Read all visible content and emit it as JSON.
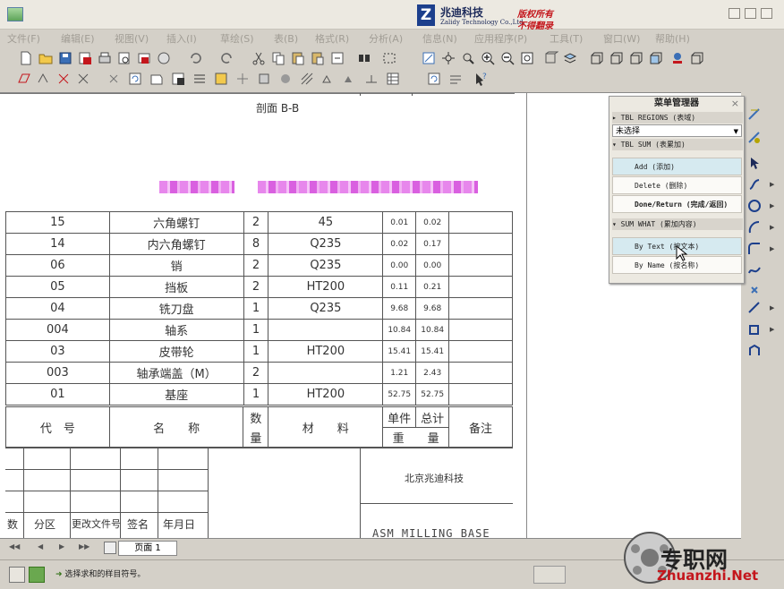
{
  "titlebar": {
    "logo_letter": "Z",
    "company": "兆迪科技",
    "company_en": "Zalidy Technology Co.,Ltd.",
    "copyright_1": "版权所有",
    "copyright_2": "不得翻录"
  },
  "menubar": {
    "items": [
      "文件(F)",
      "编辑(E)",
      "视图(V)",
      "插入(I)",
      "草绘(S)",
      "表(B)",
      "格式(R)",
      "分析(A)",
      "信息(N)",
      "应用程序(P)",
      "工具(T)",
      "窗口(W)",
      "帮助(H)"
    ]
  },
  "drawing": {
    "section_label": "剖面 B-B",
    "bom_rows": [
      {
        "code": "15",
        "name": "六角螺钉",
        "qty": "2",
        "material": "45",
        "unit_w": "0.01",
        "total_w": "0.02",
        "note": ""
      },
      {
        "code": "14",
        "name": "内六角螺钉",
        "qty": "8",
        "material": "Q235",
        "unit_w": "0.02",
        "total_w": "0.17",
        "note": ""
      },
      {
        "code": "06",
        "name": "销",
        "qty": "2",
        "material": "Q235",
        "unit_w": "0.00",
        "total_w": "0.00",
        "note": ""
      },
      {
        "code": "05",
        "name": "挡板",
        "qty": "2",
        "material": "HT200",
        "unit_w": "0.11",
        "total_w": "0.21",
        "note": ""
      },
      {
        "code": "04",
        "name": "铣刀盘",
        "qty": "1",
        "material": "Q235",
        "unit_w": "9.68",
        "total_w": "9.68",
        "note": ""
      },
      {
        "code": "004",
        "name": "轴系",
        "qty": "1",
        "material": "",
        "unit_w": "10.84",
        "total_w": "10.84",
        "note": ""
      },
      {
        "code": "03",
        "name": "皮带轮",
        "qty": "1",
        "material": "HT200",
        "unit_w": "15.41",
        "total_w": "15.41",
        "note": ""
      },
      {
        "code": "003",
        "name": "轴承端盖（M）",
        "qty": "2",
        "material": "",
        "unit_w": "1.21",
        "total_w": "2.43",
        "note": ""
      },
      {
        "code": "01",
        "name": "基座",
        "qty": "1",
        "material": "HT200",
        "unit_w": "52.75",
        "total_w": "52.75",
        "note": ""
      }
    ],
    "header": {
      "code": "代　号",
      "name": "名　　称",
      "qty_1": "数",
      "qty_2": "量",
      "material": "材　　料",
      "unit_w": "单件",
      "total_w": "总计",
      "weight": "重　　量",
      "note": "备注"
    },
    "title_block": {
      "company": "北京兆迪科技",
      "assembly_name": "ASM MILLING BASE",
      "rev_cols": [
        "数",
        "分区",
        "更改文件号",
        "签名",
        "年月日"
      ]
    }
  },
  "menu_manager": {
    "title": "菜单管理器",
    "close": "×",
    "sec_regions": "▸ TBL REGIONS (表域)",
    "region_select": "未选择",
    "sec_sum": "▾ TBL SUM (表累加)",
    "btn_add": "Add (添加)",
    "btn_delete": "Delete (删除)",
    "btn_done": "Done/Return (完成/返回)",
    "sec_sum_what": "▾ SUM WHAT (累加内容)",
    "btn_by_text": "By Text (按文本)",
    "btn_by_name": "By Name (按名称)"
  },
  "page_tabs": {
    "page_label": "页面 1"
  },
  "status": {
    "message": "选择求和的样目符号。"
  },
  "watermark": {
    "text": "专职网",
    "url": "Zhuanzhi.Net"
  },
  "colors": {
    "menu_highlight": "#d6eaf0",
    "blur_magenta": "#e787ec",
    "copyright_red": "#c4161c"
  }
}
